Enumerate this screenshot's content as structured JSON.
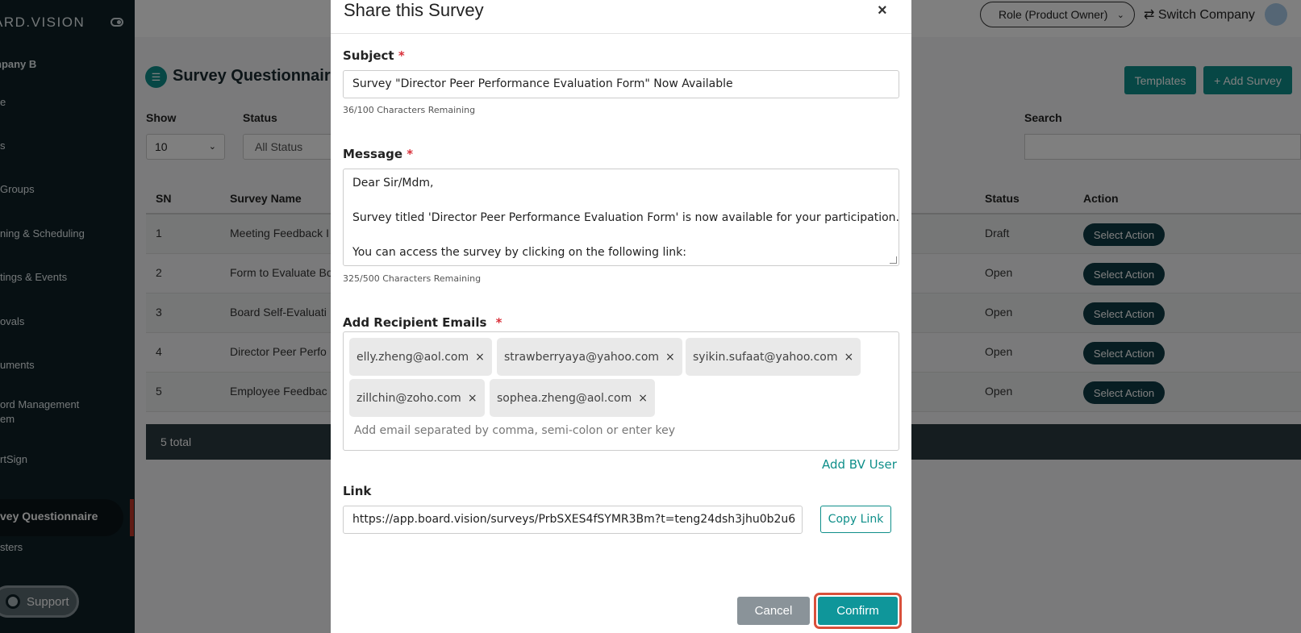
{
  "sidebar": {
    "logo": "ARD.VISION",
    "company": "npany B",
    "items": [
      {
        "label": "e"
      },
      {
        "label": "s"
      },
      {
        "label": "Groups"
      },
      {
        "label": "ning & Scheduling"
      },
      {
        "label": "tings & Events"
      },
      {
        "label": "ovals"
      },
      {
        "label": "uments"
      },
      {
        "label": "ord Management"
      },
      {
        "label": "em"
      },
      {
        "label": "rtSign"
      },
      {
        "label": "sters"
      }
    ],
    "active_item": "vey Questionnaire",
    "support_label": "Support"
  },
  "topbar": {
    "role": "Role (Product Owner)",
    "switch_company": "Switch Company"
  },
  "page": {
    "title": "Survey Questionnaire",
    "templates_button": "Templates",
    "add_survey_button": "+ Add Survey",
    "filters": {
      "show_label": "Show",
      "show_value": "10",
      "status_label": "Status",
      "status_value": "All Status",
      "search_label": "Search"
    },
    "table": {
      "headers": {
        "sn": "SN",
        "name": "Survey Name",
        "status": "Status",
        "action": "Action"
      },
      "rows": [
        {
          "sn": "1",
          "name": "Meeting Feedback I",
          "status": "Draft",
          "action": "Select Action"
        },
        {
          "sn": "2",
          "name": "Form to Evaluate Bo",
          "status": "Open",
          "action": "Select Action"
        },
        {
          "sn": "3",
          "name": "Board Self-Evaluati",
          "status": "Open",
          "action": "Select Action"
        },
        {
          "sn": "4",
          "name": "Director Peer Perfo",
          "status": "Open",
          "action": "Select Action"
        },
        {
          "sn": "5",
          "name": "Employee Feedbac",
          "status": "Open",
          "action": "Select Action"
        }
      ],
      "total": "5 total"
    }
  },
  "modal": {
    "title": "Share this Survey",
    "close": "×",
    "subject_label": "Subject",
    "required_mark": "*",
    "subject_value": "Survey \"Director Peer Performance Evaluation Form\" Now Available",
    "subject_counter": "36/100 Characters Remaining",
    "message_label": "Message",
    "message_lines": [
      "Dear Sir/Mdm,",
      "Survey titled 'Director Peer Performance Evaluation Form' is now available for your participation.",
      "You can access the survey by clicking on the following link:"
    ],
    "message_counter": "325/500 Characters Remaining",
    "recipients_label": "Add Recipient Emails",
    "recipients": [
      "elly.zheng@aol.com",
      "strawberryaya@yahoo.com",
      "syikin.sufaat@yahoo.com",
      "zillchin@zoho.com",
      "sophea.zheng@aol.com"
    ],
    "chip_remove": "×",
    "recipients_placeholder": "Add email separated by comma, semi-colon or enter key",
    "add_bv_user": "Add BV User",
    "link_label": "Link",
    "link_value": "https://app.board.vision/surveys/PrbSXES4fSYMR3Bm?t=teng24dsh3jhu0b2u6",
    "copy_link": "Copy Link",
    "cancel": "Cancel",
    "confirm": "Confirm"
  },
  "colors": {
    "accent": "#0f8f8a",
    "sidebar_bg": "#0f2027",
    "highlight_ring": "#d9503b"
  }
}
